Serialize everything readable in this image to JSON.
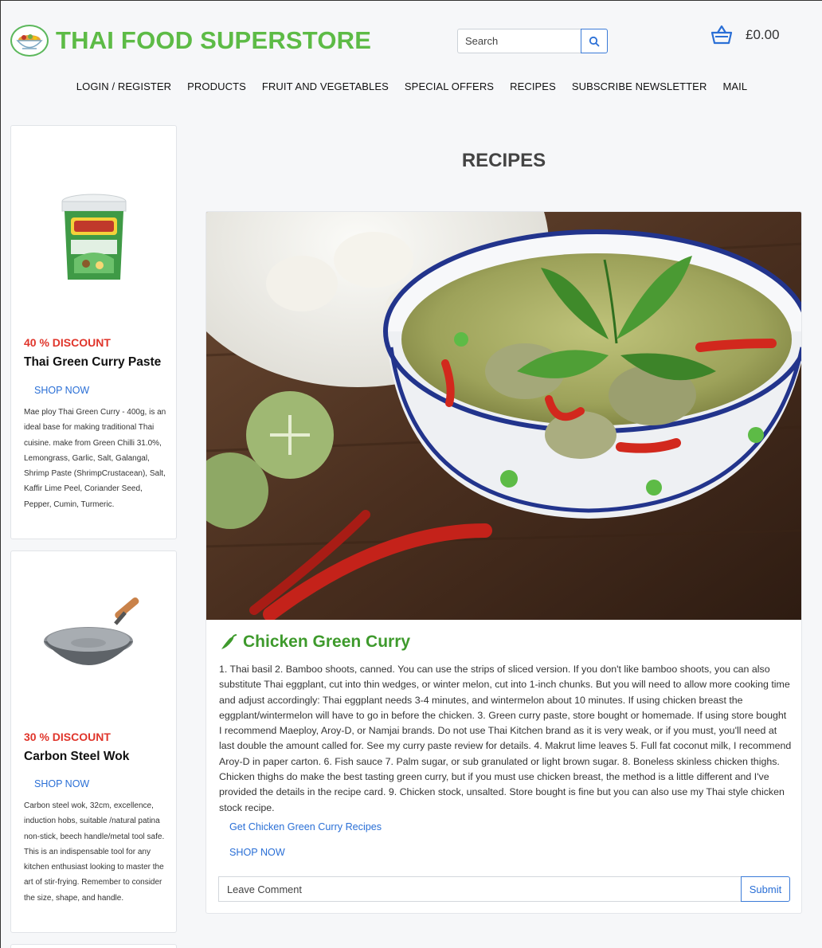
{
  "header": {
    "logo_text": "THAI FOOD SUPERSTORE",
    "search_placeholder": "Search",
    "cart_total": "£0.00",
    "brand_color": "#5dbb46"
  },
  "nav": {
    "items": [
      "LOGIN / REGISTER",
      "PRODUCTS",
      "FRUIT AND VEGETABLES",
      "SPECIAL OFFERS",
      "RECIPES",
      "SUBSCRIBE NEWSLETTER",
      "MAIL"
    ]
  },
  "sidebar": {
    "products": [
      {
        "discount": "40 % DISCOUNT",
        "name": "Thai Green Curry Paste",
        "shop_label": "SHOP NOW",
        "description": "Mae ploy Thai Green Curry - 400g, is an ideal base for making traditional Thai cuisine. make from Green Chilli 31.0%, Lemongrass, Garlic, Salt, Galangal, Shrimp Paste (ShrimpCrustacean), Salt, Kaffir Lime Peel, Coriander Seed, Pepper, Cumin, Turmeric.",
        "image_icon": "curry-paste-tub"
      },
      {
        "discount": "30 % DISCOUNT",
        "name": "Carbon Steel Wok",
        "shop_label": "SHOP NOW",
        "description": "Carbon steel wok, 32cm, excellence, induction hobs, suitable /natural patina non-stick, beech handle/metal tool safe. This is an indispensable tool for any kitchen enthusiast looking to master the art of stir-frying. Remember to consider the size, shape, and handle.",
        "image_icon": "wok"
      }
    ]
  },
  "main": {
    "page_title": "RECIPES",
    "recipe": {
      "title": "Chicken Green Curry",
      "title_icon": "chili-pepper-icon",
      "body": "1. Thai basil 2. Bamboo shoots, canned. You can use the strips of sliced version. If you don't like bamboo shoots, you can also substitute Thai eggplant, cut into thin wedges, or winter melon, cut into 1-inch chunks. But you will need to allow more cooking time and adjust accordingly: Thai eggplant needs 3-4 minutes, and wintermelon about 10 minutes. If using chicken breast the eggplant/wintermelon will have to go in before the chicken. 3. Green curry paste, store bought or homemade. If using store bought I recommend Maeploy, Aroy-D, or Namjai brands. Do not use Thai Kitchen brand as it is very weak, or if you must, you'll need at last double the amount called for. See my curry paste review for details. 4. Makrut lime leaves 5. Full fat coconut milk, I recommend Aroy-D in paper carton. 6. Fish sauce 7. Palm sugar, or sub granulated or light brown sugar. 8. Boneless skinless chicken thighs. Chicken thighs do make the best tasting green curry, but if you must use chicken breast, the method is a little different and I've provided the details in the recipe card. 9. Chicken stock, unsalted. Store bought is fine but you can also use my Thai style chicken stock recipe.",
      "link_label": "Get Chicken Green Curry Recipes",
      "shop_label": "SHOP NOW",
      "comment_placeholder": "Leave Comment",
      "submit_label": "Submit"
    }
  }
}
